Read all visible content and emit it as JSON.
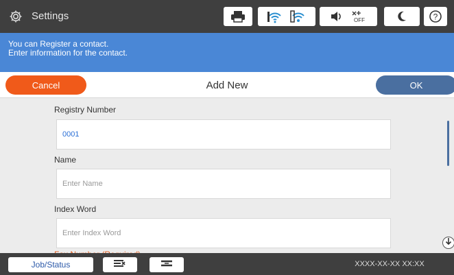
{
  "titlebar": {
    "title": "Settings",
    "icons": [
      "gear-icon",
      "printer-icon",
      "wifi-icon",
      "wifi-direct-icon",
      "sound-icon",
      "ethernet-off-icon",
      "sleep-icon",
      "help-icon"
    ]
  },
  "banner": {
    "line1": "You can Register a contact.",
    "line2": "Enter information for the contact."
  },
  "actionbar": {
    "cancel_label": "Cancel",
    "title": "Add New",
    "ok_label": "OK"
  },
  "form": {
    "registry_number": {
      "label": "Registry Number",
      "value": "0001"
    },
    "name": {
      "label": "Name",
      "placeholder": "Enter Name"
    },
    "index_word": {
      "label": "Index Word",
      "placeholder": "Enter Index Word"
    },
    "next_label_partial": "Fax Number (Required)"
  },
  "bottombar": {
    "job_status_label": "Job/Status",
    "datetime": "XXXX-XX-XX XX:XX"
  },
  "colors": {
    "titlebar": "#3f3f3f",
    "banner": "#4a87d6",
    "cancel": "#f05a1a",
    "ok": "#4a6fa0",
    "value_text": "#2a6fd6"
  }
}
